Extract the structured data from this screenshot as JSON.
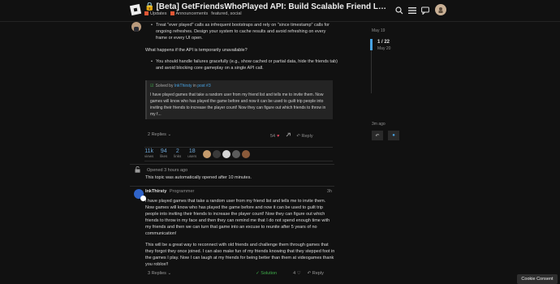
{
  "header": {
    "title_lock": "🔒",
    "title": "[Beta] GetFriendsWhoPlayed API: Build Scalable Friend Leaderboards and Social...",
    "categories": [
      {
        "label": "Updates",
        "color": "#e45735"
      },
      {
        "label": "Announcements",
        "color": "#e45735"
      },
      {
        "label": "featured, social",
        "color": ""
      }
    ],
    "icons": [
      "search-icon",
      "hamburger-icon",
      "chat-icon",
      "avatar"
    ]
  },
  "post": {
    "bullet_a": "Treat \"ever played\" calls as infrequent bootstraps and rely on \"since timestamp\" calls for ongoing refreshes. Design your system to cache results and avoid refreshing on every frame or every UI open.",
    "question": "What happens if the API is temporarily unavailable?",
    "bullet_b": "You should handle failures gracefully (e.g., show cached or partial data, hide the friends tab) and avoid blocking core gameplay on a single API call.",
    "quote": {
      "solved_by": "Solved by",
      "author": "InkThirsty",
      "in_post": "in",
      "post_link": "post #3",
      "body": "I have played games that take a random user from my friend list and tells me to invite them. Now games will know who has played the game before and now it can be used to guilt trip people into inviting their friends to increase the player count! Now they can figure out which friends to throw in my f..."
    },
    "replies_label": "2 Replies ⌄",
    "like_count": "54",
    "reply_label": "Reply"
  },
  "stats": [
    {
      "num": "11k",
      "label": "views"
    },
    {
      "num": "94",
      "label": "likes"
    },
    {
      "num": "2",
      "label": "links"
    },
    {
      "num": "18",
      "label": "users"
    }
  ],
  "system": {
    "time": "Opened 3 hours ago",
    "text": "This topic was automatically opened after 10 minutes."
  },
  "reply": {
    "username": "InkThirsty",
    "user_title": "Programmer",
    "time": "3h",
    "para1": "I have played games that take a random user from my friend list and tells me to invite them. Now games will know who has played the game before and now it can be used to guilt trip people into inviting their friends to increase the player count! Now they can figure out which friends to throw in my face and then they can remind me that I do not spend enough time with my friends and then we can turn that game into an excuse to reunite after 5 years of no communication!",
    "para2": "This will be a great way to reconnect with old friends and challenge them through games that they forgot they once joined. I can also make fun of my friends knowing that they stepped foot in the games I play. Now I can laugh at my friends for being better than them at videogames thank you roblox!!",
    "replies_label": "3 Replies ⌄",
    "solution_label": "✓ Solution",
    "like_count": "4",
    "reply_label": "Reply"
  },
  "timeline": {
    "top_date": "May 19",
    "count": "1 / 22",
    "date": "May 20",
    "bottom": "3m ago"
  },
  "cookie": "Cookie Consent"
}
